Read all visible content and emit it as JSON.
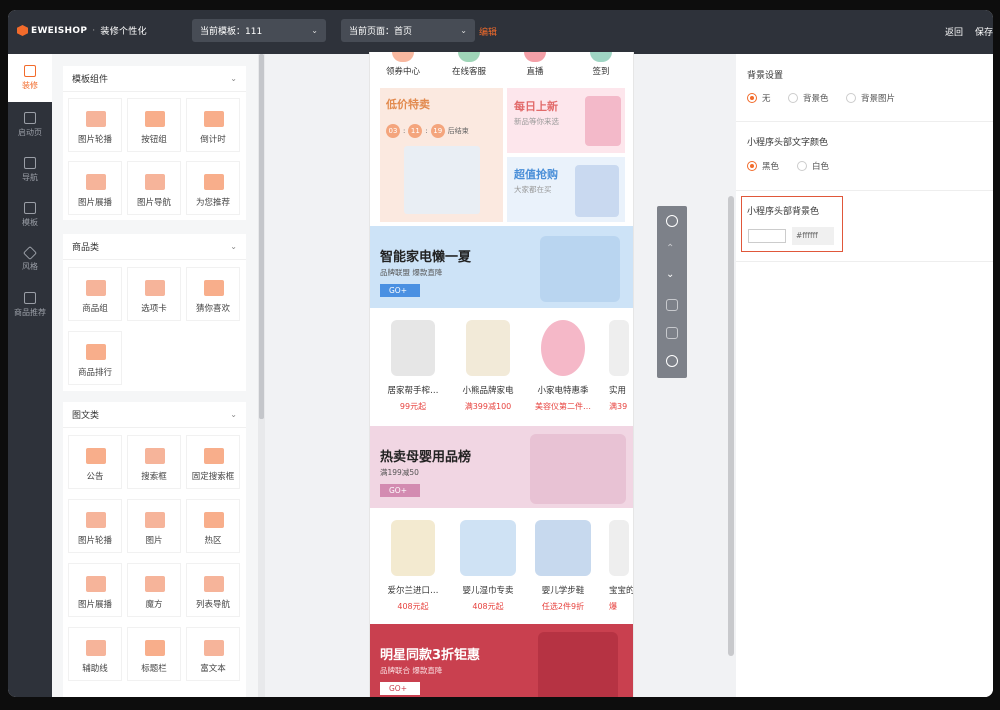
{
  "header": {
    "logo_text": "EWEISHOP",
    "separator": "·",
    "subtitle": "装修个性化",
    "template_select": "当前模板：111",
    "page_select": "当前页面：首页",
    "edit_link": "编辑",
    "back": "返回",
    "save": "保存"
  },
  "sidebar": {
    "items": [
      {
        "label": "装修",
        "icon": "brush-icon"
      },
      {
        "label": "启动页",
        "icon": "page-icon"
      },
      {
        "label": "导航",
        "icon": "grid-icon"
      },
      {
        "label": "模板",
        "icon": "template-icon"
      },
      {
        "label": "风格",
        "icon": "palette-icon"
      },
      {
        "label": "商品推荐",
        "icon": "recommend-icon"
      }
    ]
  },
  "components": {
    "groups": [
      {
        "title": "模板组件",
        "items": [
          "图片轮播",
          "按钮组",
          "倒计时",
          "图片展播",
          "图片导航",
          "为您推荐"
        ]
      },
      {
        "title": "商品类",
        "items": [
          "商品组",
          "选项卡",
          "猜你喜欢",
          "商品排行"
        ]
      },
      {
        "title": "图文类",
        "items": [
          "公告",
          "搜索框",
          "固定搜索框",
          "图片轮播",
          "图片",
          "热区",
          "图片展播",
          "魔方",
          "列表导航",
          "辅助线",
          "标题栏",
          "富文本"
        ]
      }
    ]
  },
  "preview": {
    "nav": [
      "领券中心",
      "在线客服",
      "直播",
      "签到"
    ],
    "promo": {
      "left_title": "低价特卖",
      "countdown": [
        "03",
        "11",
        "19"
      ],
      "countdown_suffix": "后结束",
      "rt_title": "每日上新",
      "rt_sub": "新品等你来选",
      "rb_title": "超值抢购",
      "rb_sub": "大家都在买"
    },
    "banners": [
      {
        "title": "智能家电懒一夏",
        "sub": "品牌联盟 爆款直降",
        "go": "GO+"
      },
      {
        "title": "热卖母婴用品榜",
        "sub": "满199减50",
        "go": "GO+"
      },
      {
        "title": "明星同款3折钜惠",
        "sub": "品牌联合 爆款直降",
        "go": "GO+"
      }
    ],
    "products_1": [
      {
        "name": "居家帮手榨…",
        "price": "99元起"
      },
      {
        "name": "小熊品牌家电",
        "price": "满399减100"
      },
      {
        "name": "小家电特惠季",
        "price": "美容仪第二件…"
      },
      {
        "name": "实用",
        "price": "满39"
      }
    ],
    "products_2": [
      {
        "name": "爱尔兰进口…",
        "price": "408元起"
      },
      {
        "name": "婴儿湿巾专卖",
        "price": "408元起"
      },
      {
        "name": "婴儿学步鞋",
        "price": "任选2件9折"
      },
      {
        "name": "宝宝的",
        "price": "爆"
      }
    ]
  },
  "settings": {
    "bg_label": "背景设置",
    "bg_options": [
      "无",
      "背景色",
      "背景图片"
    ],
    "bg_selected": "无",
    "text_color_label": "小程序头部文字颜色",
    "text_color_options": [
      "黑色",
      "白色"
    ],
    "text_color_selected": "黑色",
    "header_bg_label": "小程序头部背景色",
    "header_bg_value": "#ffffff"
  }
}
